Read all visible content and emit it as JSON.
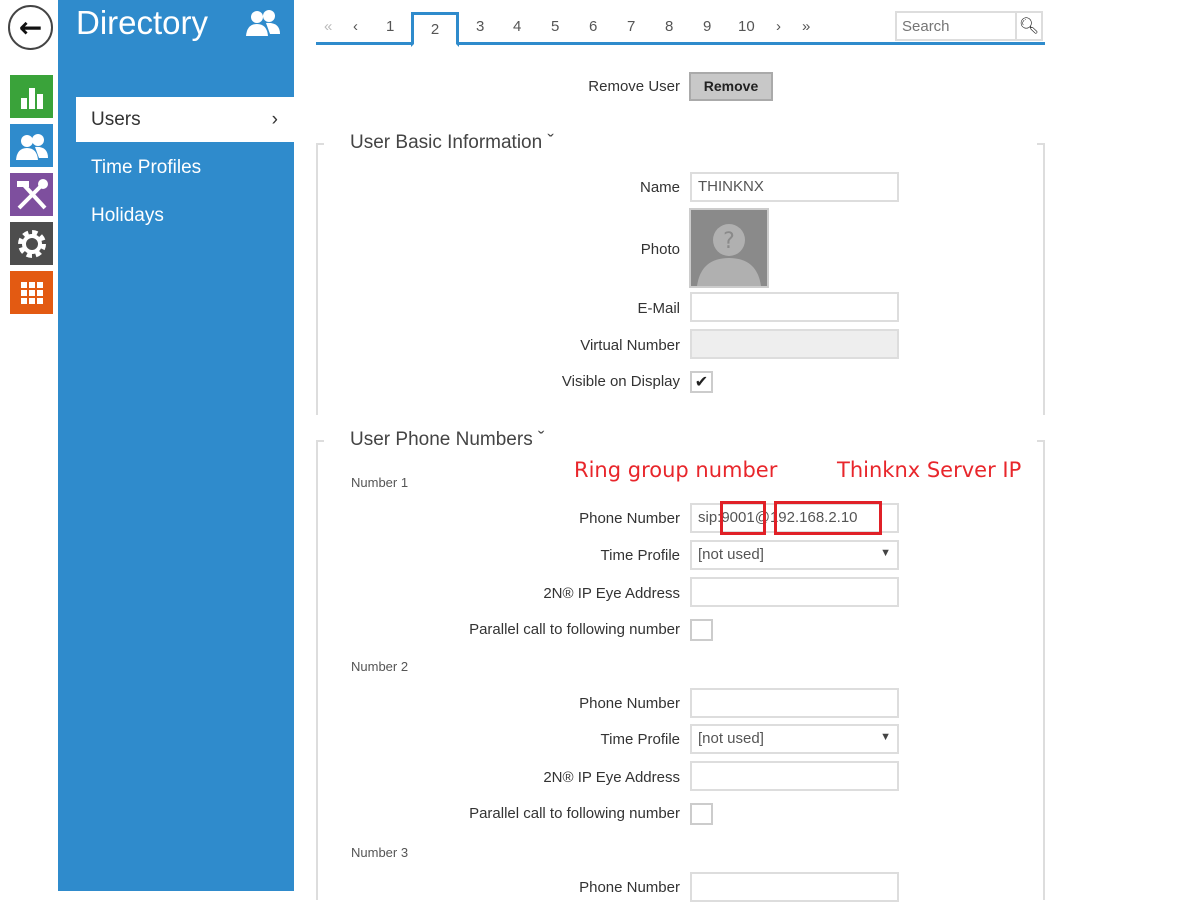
{
  "nav_icons": [
    {
      "name": "status",
      "color": "#3aa33a"
    },
    {
      "name": "directory",
      "color": "#2f8bcc"
    },
    {
      "name": "hardware",
      "color": "#7e4f9e"
    },
    {
      "name": "system",
      "color": "#4d4d4d"
    },
    {
      "name": "services",
      "color": "#e35a12"
    }
  ],
  "sidebar": {
    "title": "Directory",
    "items": [
      {
        "label": "Users",
        "chevron": "›"
      },
      {
        "label": "Time Profiles"
      },
      {
        "label": "Holidays"
      }
    ]
  },
  "pager": {
    "first": "«",
    "prev": "‹",
    "pages": [
      "1",
      "2",
      "3",
      "4",
      "5",
      "6",
      "7",
      "8",
      "9",
      "10"
    ],
    "current": "2",
    "next": "›",
    "last": "»"
  },
  "search": {
    "placeholder": "Search"
  },
  "remove": {
    "label": "Remove User",
    "button": "Remove"
  },
  "basic": {
    "title": "User Basic Information ˇ",
    "name_label": "Name",
    "name_value": "THINKNX",
    "photo_label": "Photo",
    "email_label": "E-Mail",
    "virtual_label": "Virtual Number",
    "visible_label": "Visible on Display",
    "visible_checked": true
  },
  "phones": {
    "title": "User Phone Numbers ˇ",
    "annotations": {
      "ring": "Ring group number",
      "server": "Thinknx Server IP"
    },
    "labels": {
      "phone": "Phone Number",
      "time": "Time Profile",
      "eye": "2N® IP Eye Address",
      "parallel": "Parallel call to following number"
    },
    "numbers": [
      {
        "title": "Number 1",
        "phone": "sip:9001@192.168.2.10",
        "time": "[not used]"
      },
      {
        "title": "Number 2",
        "phone": "",
        "time": "[not used]"
      },
      {
        "title": "Number 3",
        "phone": ""
      }
    ]
  }
}
